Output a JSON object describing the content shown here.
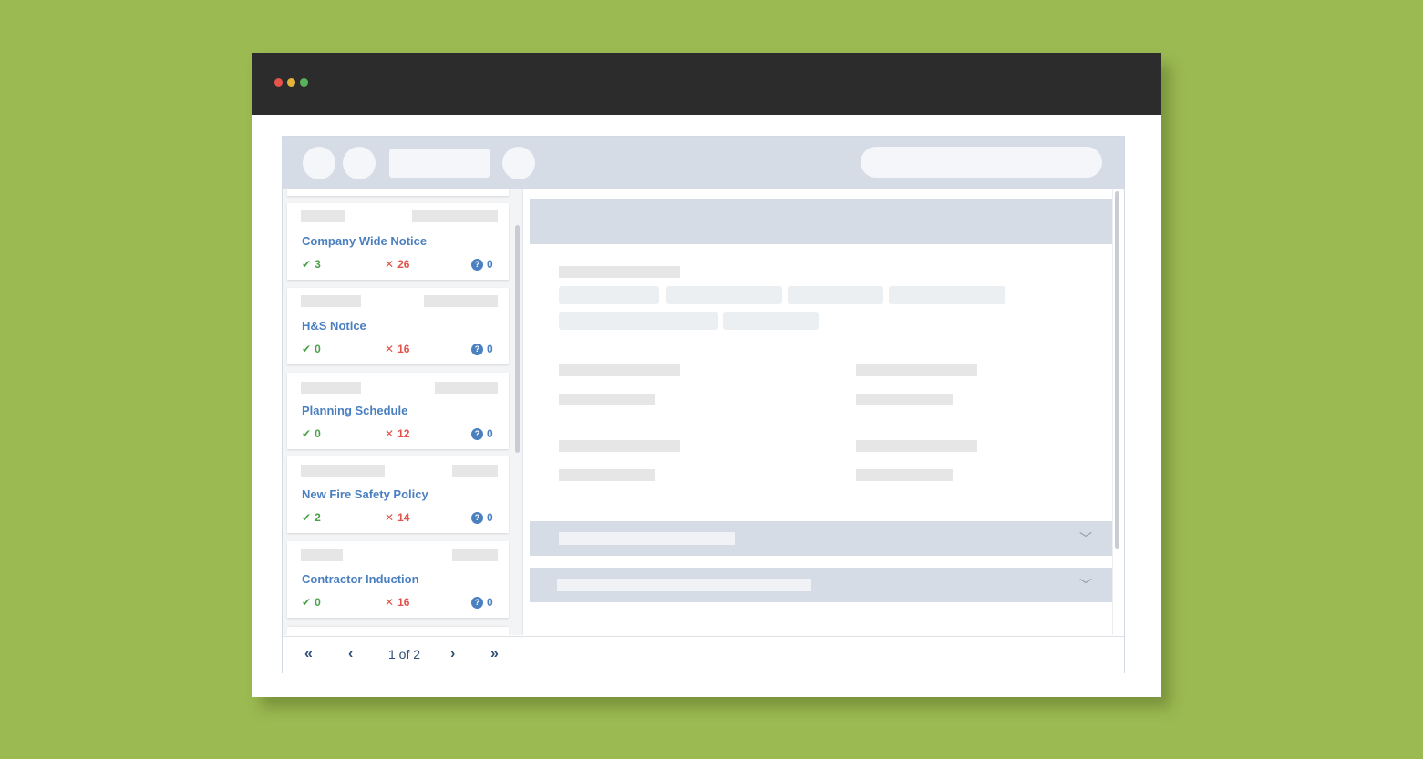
{
  "window": {
    "controls": [
      "close",
      "minimize",
      "maximize"
    ]
  },
  "sidebar": {
    "items": [
      {
        "title": "Company Wide Notice",
        "accepted": "3",
        "rejected": "26",
        "unknown": "0"
      },
      {
        "title": "H&S Notice",
        "accepted": "0",
        "rejected": "16",
        "unknown": "0"
      },
      {
        "title": "Planning Schedule",
        "accepted": "0",
        "rejected": "12",
        "unknown": "0"
      },
      {
        "title": "New Fire Safety Policy",
        "accepted": "2",
        "rejected": "14",
        "unknown": "0"
      },
      {
        "title": "Contractor Induction",
        "accepted": "0",
        "rejected": "16",
        "unknown": "0"
      }
    ]
  },
  "icons": {
    "accepted": "check-icon",
    "rejected": "cross-icon",
    "unknown": "question-circle-icon",
    "first": "double-chevron-left-icon",
    "prev": "chevron-left-icon",
    "next": "chevron-right-icon",
    "last": "double-chevron-right-icon",
    "expand": "chevron-down-icon"
  },
  "pager": {
    "first": "«",
    "prev": "‹",
    "label": "1 of 2",
    "next": "›",
    "last": "»"
  },
  "colors": {
    "background": "#9cba52",
    "titlebar": "#2c2c2c",
    "accepted": "#48a048",
    "rejected": "#e2534b",
    "link": "#4a7fc0",
    "panel": "#d5dce6"
  }
}
